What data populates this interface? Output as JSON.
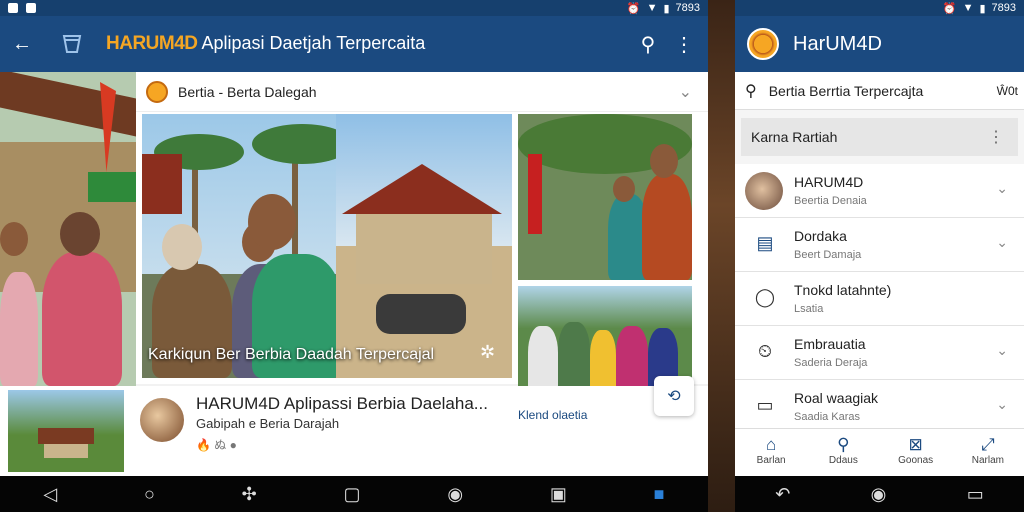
{
  "left": {
    "status": {
      "time": "7893"
    },
    "appbar": {
      "brand": "HARUM4D",
      "title": "Aplipasi Daetjah Terpercaita"
    },
    "feed": {
      "header_title": "Bertia - Berta Dalegah",
      "hero_caption": "Karkiqun Ber Berbia Daadah Terpercajal",
      "side_caption": "Klend olaetia",
      "article": {
        "title": "HARUM4D Aplipassi Berbia Daelaha...",
        "subtitle": "Gabipah e Beria Darajah",
        "meta": "🔥 ぬ ●"
      }
    }
  },
  "right": {
    "status": {
      "time": "7893"
    },
    "appbar": {
      "title": "HarUM4D"
    },
    "search": {
      "placeholder": "Bertia Berrtia Terpercajta",
      "action": "Ŵ0t"
    },
    "section": {
      "title": "Karna Rartiah"
    },
    "items": [
      {
        "title": "HARUM4D",
        "subtitle": "Beertia Denaia",
        "icon": "avatar-icon"
      },
      {
        "title": "Dordaka",
        "subtitle": "Beert Damaja",
        "icon": "news-icon"
      },
      {
        "title": "Tnokd latahnte)",
        "subtitle": "Lsatia",
        "icon": "chat-icon"
      },
      {
        "title": "Embrauatia",
        "subtitle": "Saderia Deraja",
        "icon": "alarm-icon"
      },
      {
        "title": "Roal waagiak",
        "subtitle": "Saadia Karas",
        "icon": "doc-icon"
      }
    ],
    "tabs": [
      {
        "label": "Barlan",
        "icon": "home-icon"
      },
      {
        "label": "Ddaus",
        "icon": "search-icon"
      },
      {
        "label": "Goonas",
        "icon": "inbox-icon"
      },
      {
        "label": "Narlam",
        "icon": "expand-icon"
      }
    ]
  },
  "colors": {
    "appbar": "#1b4a80",
    "brand": "#f5a623",
    "nav": "#050505"
  }
}
